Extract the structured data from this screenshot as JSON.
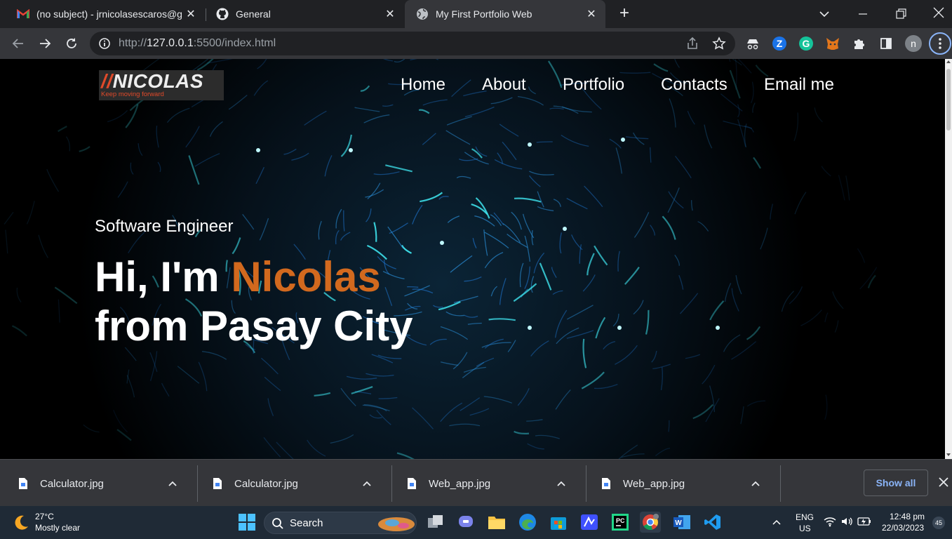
{
  "browser": {
    "tabs": [
      {
        "title": "(no subject) - jrnicolasescaros@g",
        "icon": "gmail-icon"
      },
      {
        "title": "General",
        "icon": "github-icon"
      },
      {
        "title": "My First Portfolio Web",
        "icon": "globe-icon",
        "active": true
      }
    ],
    "url_prefix": "http://",
    "url_host": "127.0.0.1",
    "url_rest": ":5500/index.html",
    "profile_initial": "n"
  },
  "site": {
    "logo_slash": "//",
    "logo_text": "NICOLAS",
    "logo_tagline": "Keep moving forward",
    "nav": [
      "Home",
      "About",
      "Portfolio",
      "Contacts",
      "Email me"
    ],
    "hero_subtitle": "Software Engineer",
    "hero_greeting": "Hi, I'm",
    "hero_name": "Nicolas",
    "hero_location": "from Pasay City",
    "accent_color": "#d2691e"
  },
  "downloads": {
    "items": [
      "Calculator.jpg",
      "Calculator.jpg",
      "Web_app.jpg",
      "Web_app.jpg"
    ],
    "show_all": "Show all"
  },
  "taskbar": {
    "weather_temp": "27°C",
    "weather_desc": "Mostly clear",
    "search_label": "Search",
    "lang_top": "ENG",
    "lang_bottom": "US",
    "time": "12:48 pm",
    "date": "22/03/2023",
    "notification_count": "45"
  }
}
